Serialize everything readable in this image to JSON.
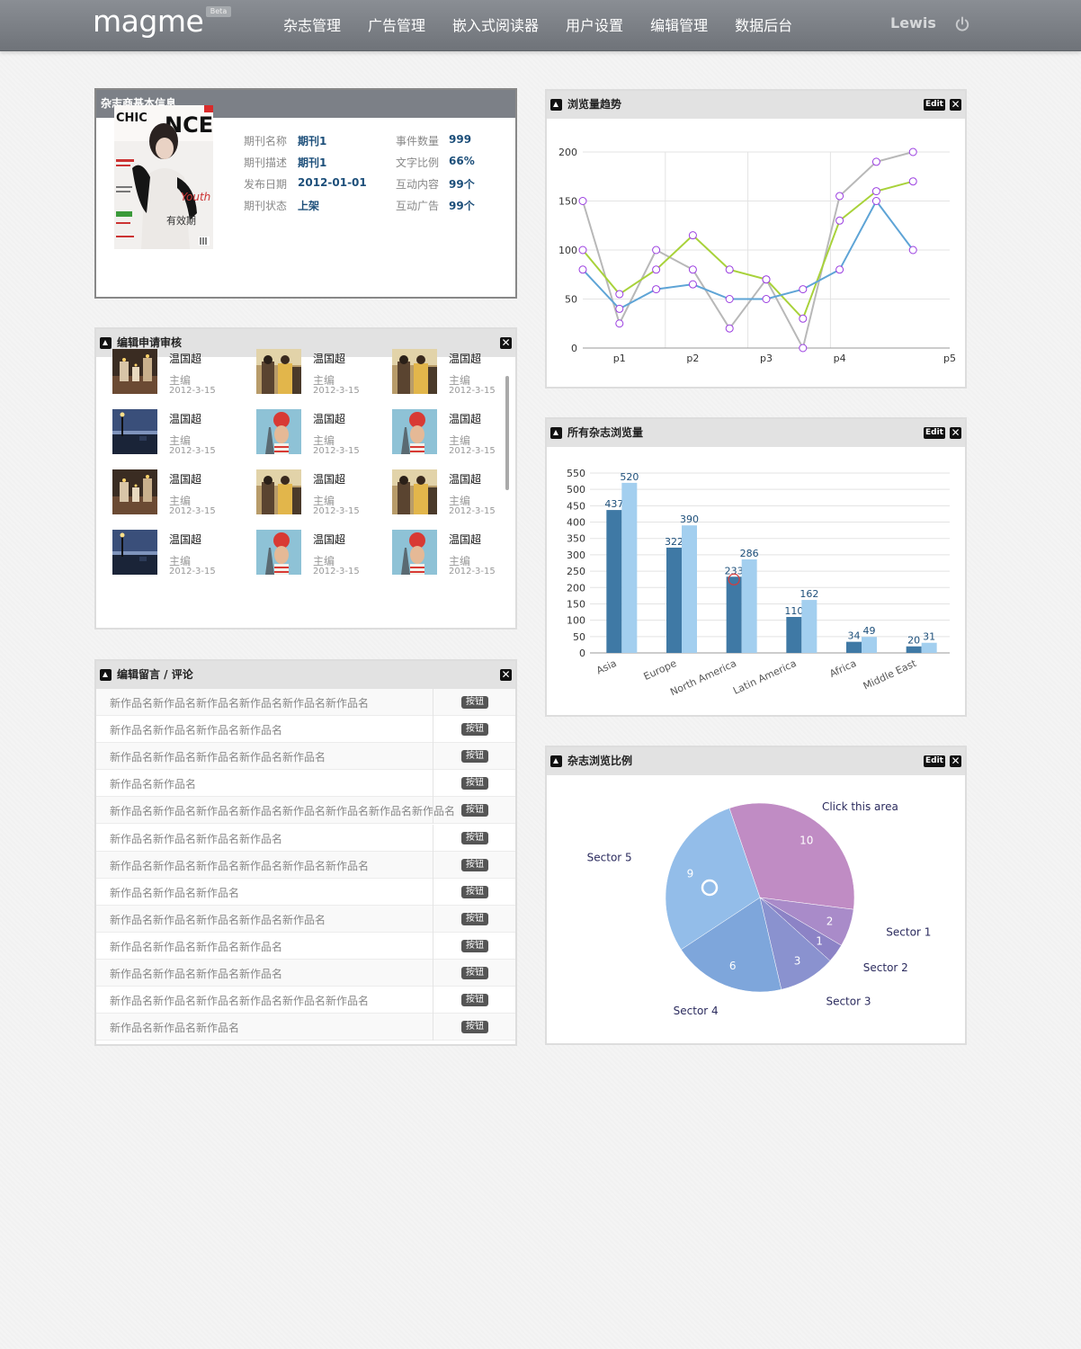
{
  "header": {
    "logo": "magme",
    "beta": "Beta",
    "nav": [
      "杂志管理",
      "广告管理",
      "嵌入式阅读器",
      "用户设置",
      "编辑管理",
      "数据后台"
    ],
    "user": "Lewis"
  },
  "info": {
    "title": "杂志商基本信息",
    "left": [
      {
        "k": "期刊名称",
        "v": "期刊1"
      },
      {
        "k": "期刊描述",
        "v": "期刊1"
      },
      {
        "k": "发布日期",
        "v": "2012-01-01"
      },
      {
        "k": "期刊状态",
        "v": "上架"
      }
    ],
    "right": [
      {
        "k": "事件数量",
        "v": "999"
      },
      {
        "k": "文字比例",
        "v": "66%"
      },
      {
        "k": "互动内容",
        "v": "99个"
      },
      {
        "k": "互动广告",
        "v": "99个"
      }
    ]
  },
  "review": {
    "title": "编辑申请审核",
    "items": [
      {
        "name": "温国超",
        "role": "主编",
        "date": "2012-3-15",
        "thumb": "candles"
      },
      {
        "name": "温国超",
        "role": "主编",
        "date": "2012-3-15",
        "thumb": "people"
      },
      {
        "name": "温国超",
        "role": "主编",
        "date": "2012-3-15",
        "thumb": "people"
      },
      {
        "name": "温国超",
        "role": "主编",
        "date": "2012-3-15",
        "thumb": "harbor"
      },
      {
        "name": "温国超",
        "role": "主编",
        "date": "2012-3-15",
        "thumb": "eiffel"
      },
      {
        "name": "温国超",
        "role": "主编",
        "date": "2012-3-15",
        "thumb": "eiffel"
      },
      {
        "name": "温国超",
        "role": "主编",
        "date": "2012-3-15",
        "thumb": "candles"
      },
      {
        "name": "温国超",
        "role": "主编",
        "date": "2012-3-15",
        "thumb": "people"
      },
      {
        "name": "温国超",
        "role": "主编",
        "date": "2012-3-15",
        "thumb": "people"
      },
      {
        "name": "温国超",
        "role": "主编",
        "date": "2012-3-15",
        "thumb": "harbor"
      },
      {
        "name": "温国超",
        "role": "主编",
        "date": "2012-3-15",
        "thumb": "eiffel"
      },
      {
        "name": "温国超",
        "role": "主编",
        "date": "2012-3-15",
        "thumb": "eiffel"
      }
    ]
  },
  "comments": {
    "title": "编辑留言 / 评论",
    "button_label": "按钮",
    "rows": [
      "新作品名新作品名新作品名新作品名新作品名新作品名",
      "新作品名新作品名新作品名新作品名",
      "新作品名新作品名新作品名新作品名新作品名",
      "新作品名新作品名",
      "新作品名新作品名新作品名新作品名新作品名新作品名新作品名新作品名",
      "新作品名新作品名新作品名新作品名",
      "新作品名新作品名新作品名新作品名新作品名新作品名",
      "新作品名新作品名新作品名",
      "新作品名新作品名新作品名新作品名新作品名",
      "新作品名新作品名新作品名新作品名",
      "新作品名新作品名新作品名新作品名",
      "新作品名新作品名新作品名新作品名新作品名新作品名",
      "新作品名新作品名新作品名"
    ]
  },
  "line_panel": {
    "title": "浏览量趋势",
    "edit": "Edit"
  },
  "bar_panel": {
    "title": "所有杂志浏览量",
    "edit": "Edit"
  },
  "pie_panel": {
    "title": "杂志浏览比例",
    "edit": "Edit"
  },
  "chart_data": [
    {
      "type": "line",
      "title": "",
      "x": [
        0,
        0.5,
        1,
        1.5,
        2,
        2.5,
        3,
        3.5,
        4,
        4.5,
        5
      ],
      "xticks": [
        "p1",
        "p2",
        "p3",
        "p4",
        "p5"
      ],
      "ylim": [
        0,
        200
      ],
      "yticks": [
        0,
        50,
        100,
        150,
        200
      ],
      "grid": true,
      "series": [
        {
          "color": "#b8b8b8",
          "values": [
            150,
            25,
            100,
            80,
            20,
            70,
            0,
            155,
            190,
            200,
            null
          ]
        },
        {
          "color": "#a8d23a",
          "values": [
            100,
            55,
            80,
            115,
            80,
            70,
            30,
            130,
            160,
            170,
            null
          ]
        },
        {
          "color": "#5ea4d6",
          "values": [
            80,
            40,
            60,
            65,
            50,
            50,
            60,
            80,
            150,
            100,
            null
          ]
        }
      ],
      "marker_color": "#9a3de0"
    },
    {
      "type": "bar",
      "title": "",
      "categories": [
        "Asia",
        "Europe",
        "North America",
        "Latin America",
        "Africa",
        "Middle East"
      ],
      "ylim": [
        0,
        550
      ],
      "yticks": [
        0,
        50,
        100,
        150,
        200,
        250,
        300,
        350,
        400,
        450,
        500,
        550
      ],
      "grid": true,
      "series": [
        {
          "color": "#3f79a5",
          "values": [
            437,
            322,
            233,
            110,
            34,
            20
          ]
        },
        {
          "color": "#a3cfef",
          "values": [
            520,
            390,
            286,
            162,
            49,
            31
          ]
        }
      ]
    },
    {
      "type": "pie",
      "title": "",
      "slices": [
        {
          "label": "Click this area",
          "value": 10,
          "color": "#c08cc4"
        },
        {
          "label": "Sector 1",
          "value": 2,
          "color": "#a98bc9"
        },
        {
          "label": "Sector 2",
          "value": 1,
          "color": "#8c83c6"
        },
        {
          "label": "Sector 3",
          "value": 3,
          "color": "#8a92cf"
        },
        {
          "label": "Sector 4",
          "value": 6,
          "color": "#7ea6db"
        },
        {
          "label": "Sector 5",
          "value": 9,
          "color": "#93bde9"
        }
      ]
    }
  ]
}
